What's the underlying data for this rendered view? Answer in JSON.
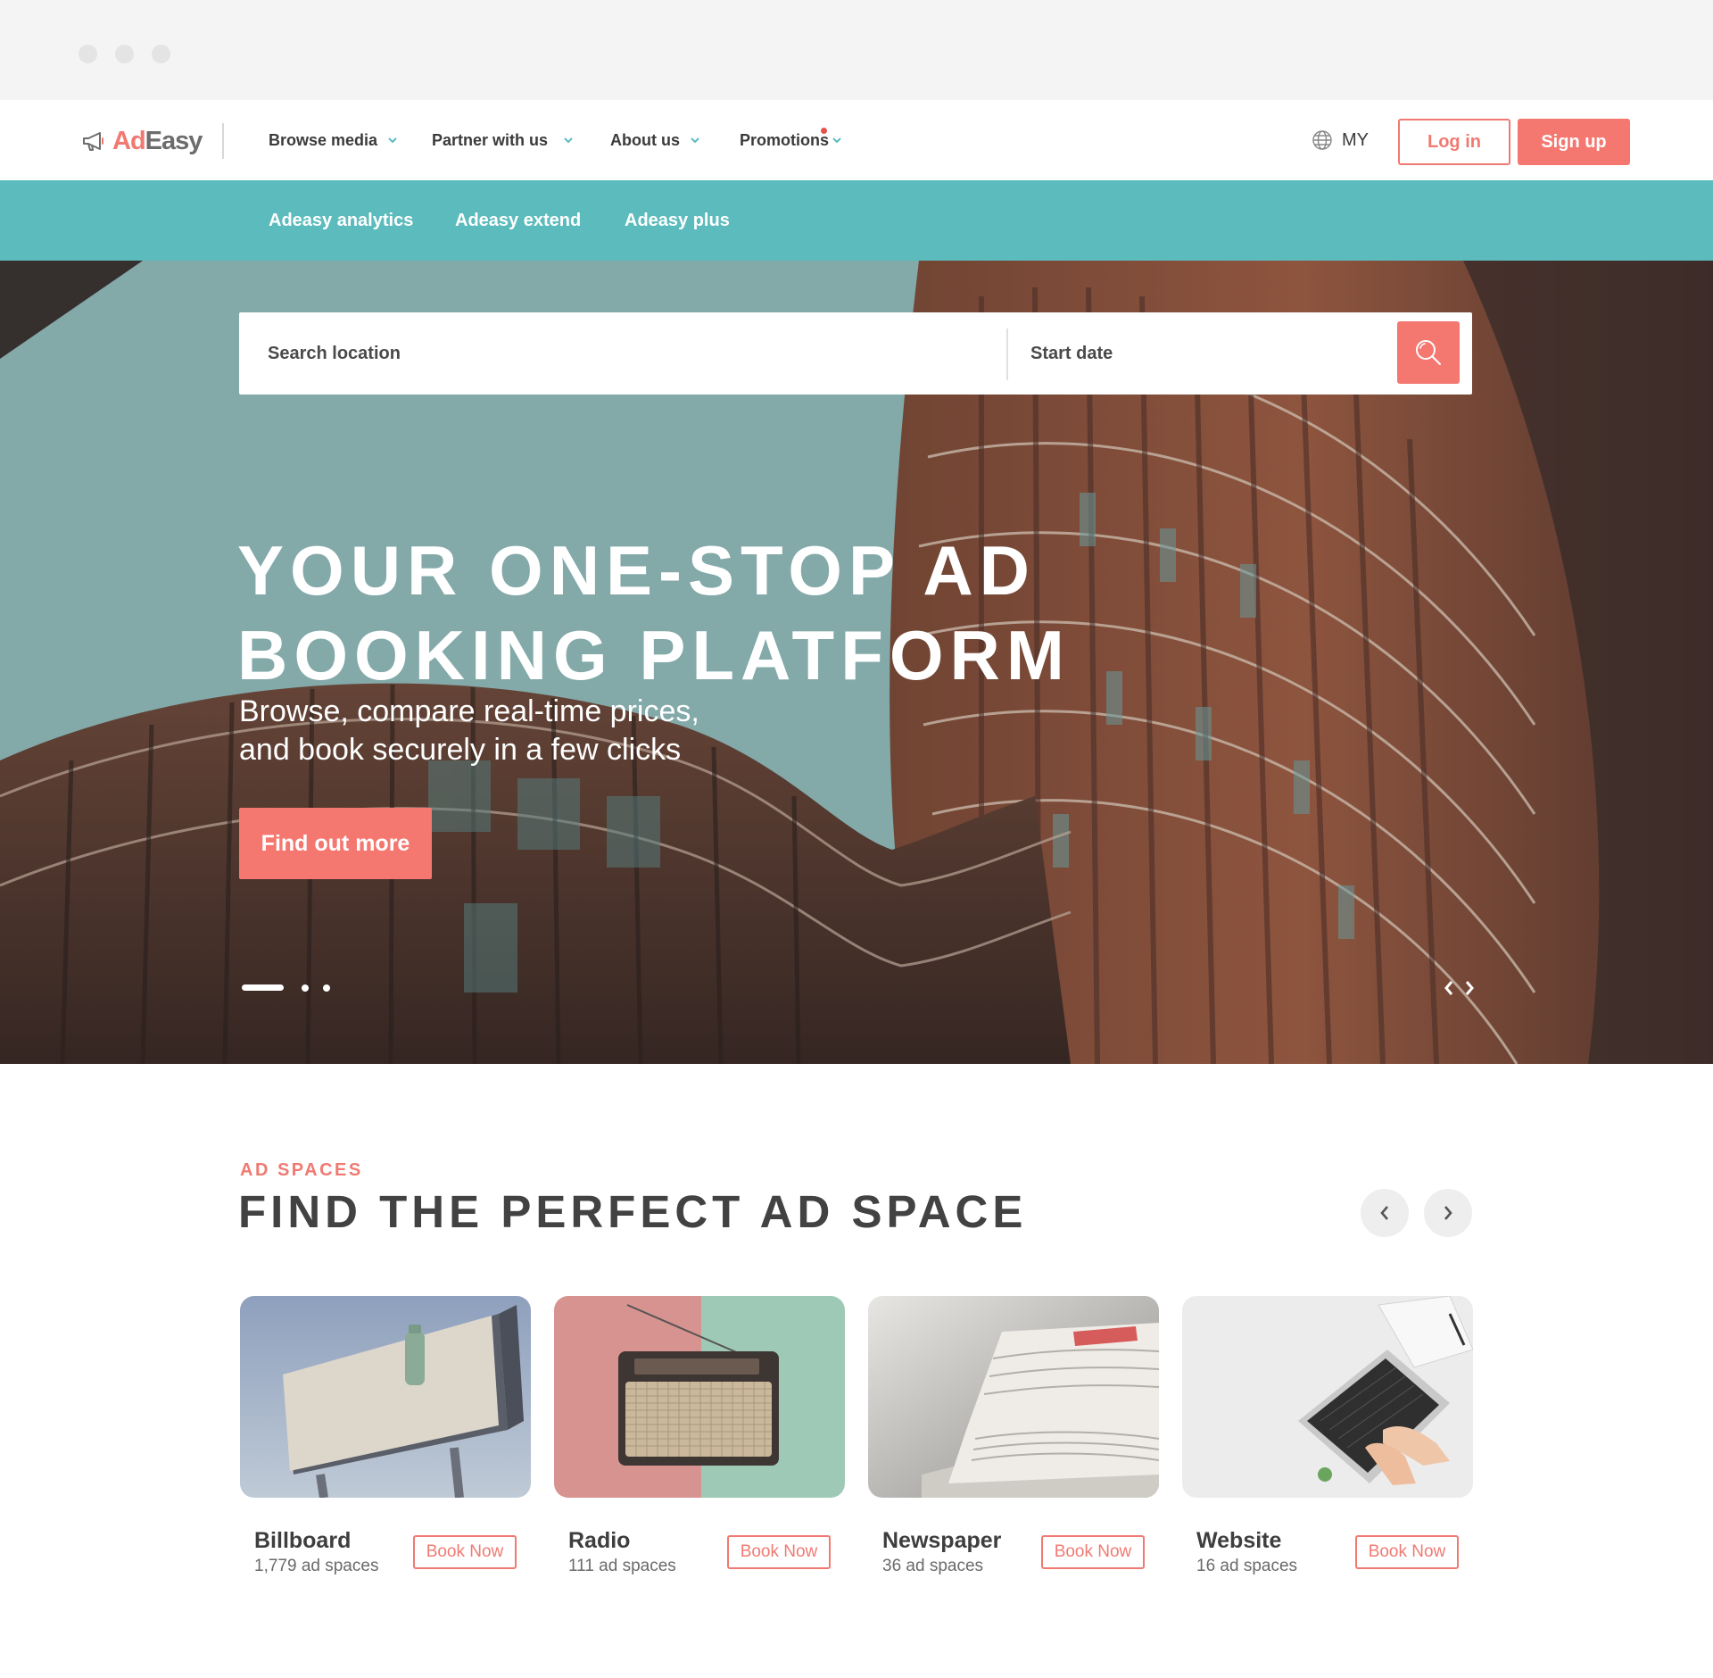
{
  "header": {
    "logo_text_a": "Ad",
    "logo_text_b": "Easy",
    "nav": [
      {
        "label": "Browse media",
        "has_badge": false
      },
      {
        "label": "Partner with us",
        "has_badge": false
      },
      {
        "label": "About us",
        "has_badge": false
      },
      {
        "label": "Promotions",
        "has_badge": true
      }
    ],
    "region": "MY",
    "login_label": "Log in",
    "signup_label": "Sign up"
  },
  "subnav": {
    "items": [
      "Adeasy analytics",
      "Adeasy extend",
      "Adeasy plus"
    ]
  },
  "search": {
    "location_placeholder": "Search location",
    "date_placeholder": "Start date"
  },
  "hero": {
    "title_line1": "YOUR ONE-STOP AD",
    "title_line2": "BOOKING PLATFORM",
    "subtitle_line1": "Browse, compare real-time prices,",
    "subtitle_line2": "and book securely in a few clicks",
    "cta_label": "Find out more",
    "slide_count": 3,
    "active_slide": 1
  },
  "ad_spaces": {
    "eyebrow": "AD SPACES",
    "title": "FIND THE PERFECT AD SPACE",
    "cards": [
      {
        "name": "Billboard",
        "count": "1,779 ad spaces",
        "cta": "Book Now",
        "image": "billboard-image"
      },
      {
        "name": "Radio",
        "count": "111 ad spaces",
        "cta": "Book Now",
        "image": "radio-image"
      },
      {
        "name": "Newspaper",
        "count": "36 ad spaces",
        "cta": "Book Now",
        "image": "newspaper-image"
      },
      {
        "name": "Website",
        "count": "16 ad spaces",
        "cta": "Book Now",
        "image": "laptop-image"
      }
    ]
  },
  "colors": {
    "accent": "#f47770",
    "teal": "#5cbbbc",
    "text_dark": "#3e3e3e"
  }
}
